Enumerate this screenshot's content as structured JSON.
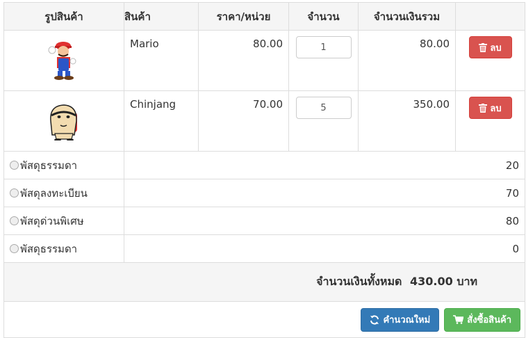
{
  "headers": {
    "image": "รูปสินค้า",
    "product": "สินค้า",
    "unit_price": "ราคา/หน่วย",
    "quantity": "จำนวน",
    "line_total": "จำนวนเงินรวม"
  },
  "items": [
    {
      "name": "Mario",
      "price": "80.00",
      "qty": "1",
      "total": "80.00",
      "delete_label": "ลบ"
    },
    {
      "name": "Chinjang",
      "price": "70.00",
      "qty": "5",
      "total": "350.00",
      "delete_label": "ลบ"
    }
  ],
  "shipping": [
    {
      "label": "พัสดุธรรมดา",
      "price": "20"
    },
    {
      "label": "พัสดุลงทะเบียน",
      "price": "70"
    },
    {
      "label": "พัสดุด่วนพิเศษ",
      "price": "80"
    },
    {
      "label": "พัสดุธรรมดา",
      "price": "0"
    }
  ],
  "summary": {
    "label": "จำนวนเงินทั้งหมด",
    "amount": "430.00",
    "currency": "บาท"
  },
  "actions": {
    "recalculate": "คำนวณใหม่",
    "order": "สั่งซื้อสินค้า"
  },
  "colors": {
    "delete": "#d9534f",
    "recalculate": "#337ab7",
    "order": "#5cb85c"
  },
  "icons": {
    "delete": "trash-icon",
    "recalculate": "refresh-icon",
    "order": "cart-icon"
  }
}
